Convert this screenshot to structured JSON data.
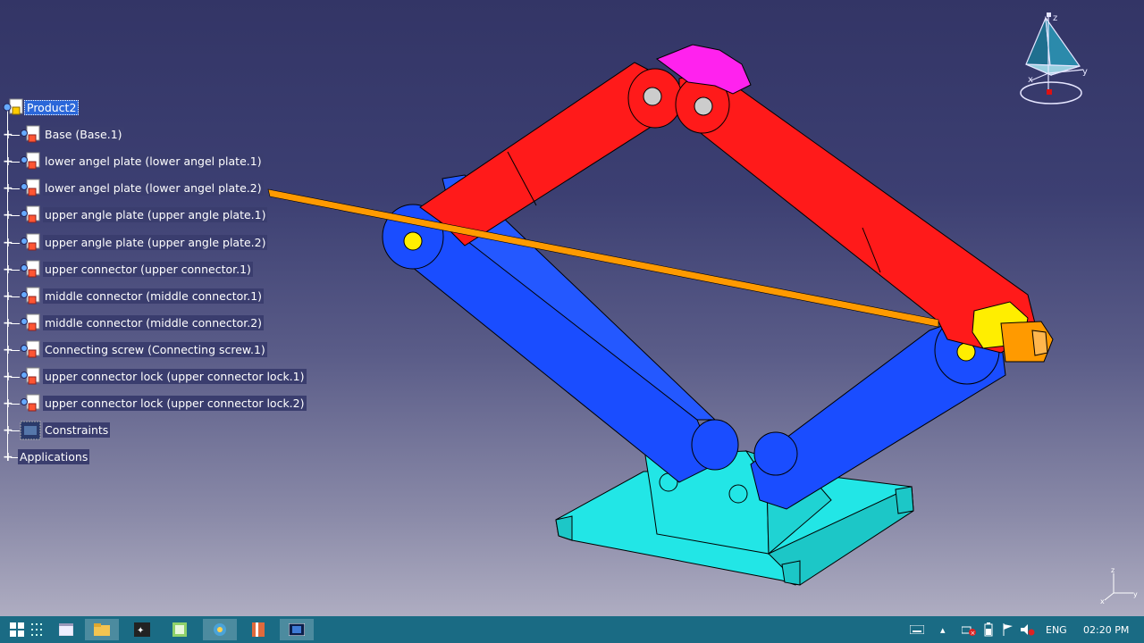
{
  "tree": {
    "root": {
      "label": "Product2"
    },
    "nodes": [
      {
        "label": "Base (Base.1)",
        "icon": "part-icon"
      },
      {
        "label": "lower angel plate (lower angel plate.1)",
        "icon": "part-icon"
      },
      {
        "label": "lower angel plate (lower angel plate.2)",
        "icon": "part-icon"
      },
      {
        "label": "upper angle plate (upper angle plate.1)",
        "icon": "part-icon"
      },
      {
        "label": "upper angle plate (upper angle plate.2)",
        "icon": "part-icon"
      },
      {
        "label": "upper connector (upper connector.1)",
        "icon": "part-icon"
      },
      {
        "label": "middle connector (middle connector.1)",
        "icon": "part-icon"
      },
      {
        "label": "middle connector (middle connector.2)",
        "icon": "part-icon"
      },
      {
        "label": "Connecting screw (Connecting screw.1)",
        "icon": "part-icon"
      },
      {
        "label": "upper connector lock (upper connector lock.1)",
        "icon": "part-icon"
      },
      {
        "label": "upper connector lock (upper connector lock.2)",
        "icon": "part-icon"
      },
      {
        "label": "Constraints",
        "icon": "constraints-icon"
      },
      {
        "label": "Applications",
        "icon": "none"
      }
    ]
  },
  "model": {
    "colors": {
      "upper_plates": "#ff1a1a",
      "lower_plates": "#1a4dff",
      "base": "#22e6e6",
      "upper_connector": "#ff22ee",
      "screw": "#ff9a00",
      "lock": "#ffee00"
    }
  },
  "compass": {
    "x_label": "x",
    "y_label": "y",
    "z_label": "z"
  },
  "taskbar": {
    "apps": [
      "start-icon",
      "task-view-icon",
      "file-explorer-icon",
      "app-icon-1",
      "app-icon-2",
      "catia-icon",
      "app-icon-3",
      "app-icon-4"
    ],
    "language": "ENG",
    "time": "02:20 PM"
  }
}
